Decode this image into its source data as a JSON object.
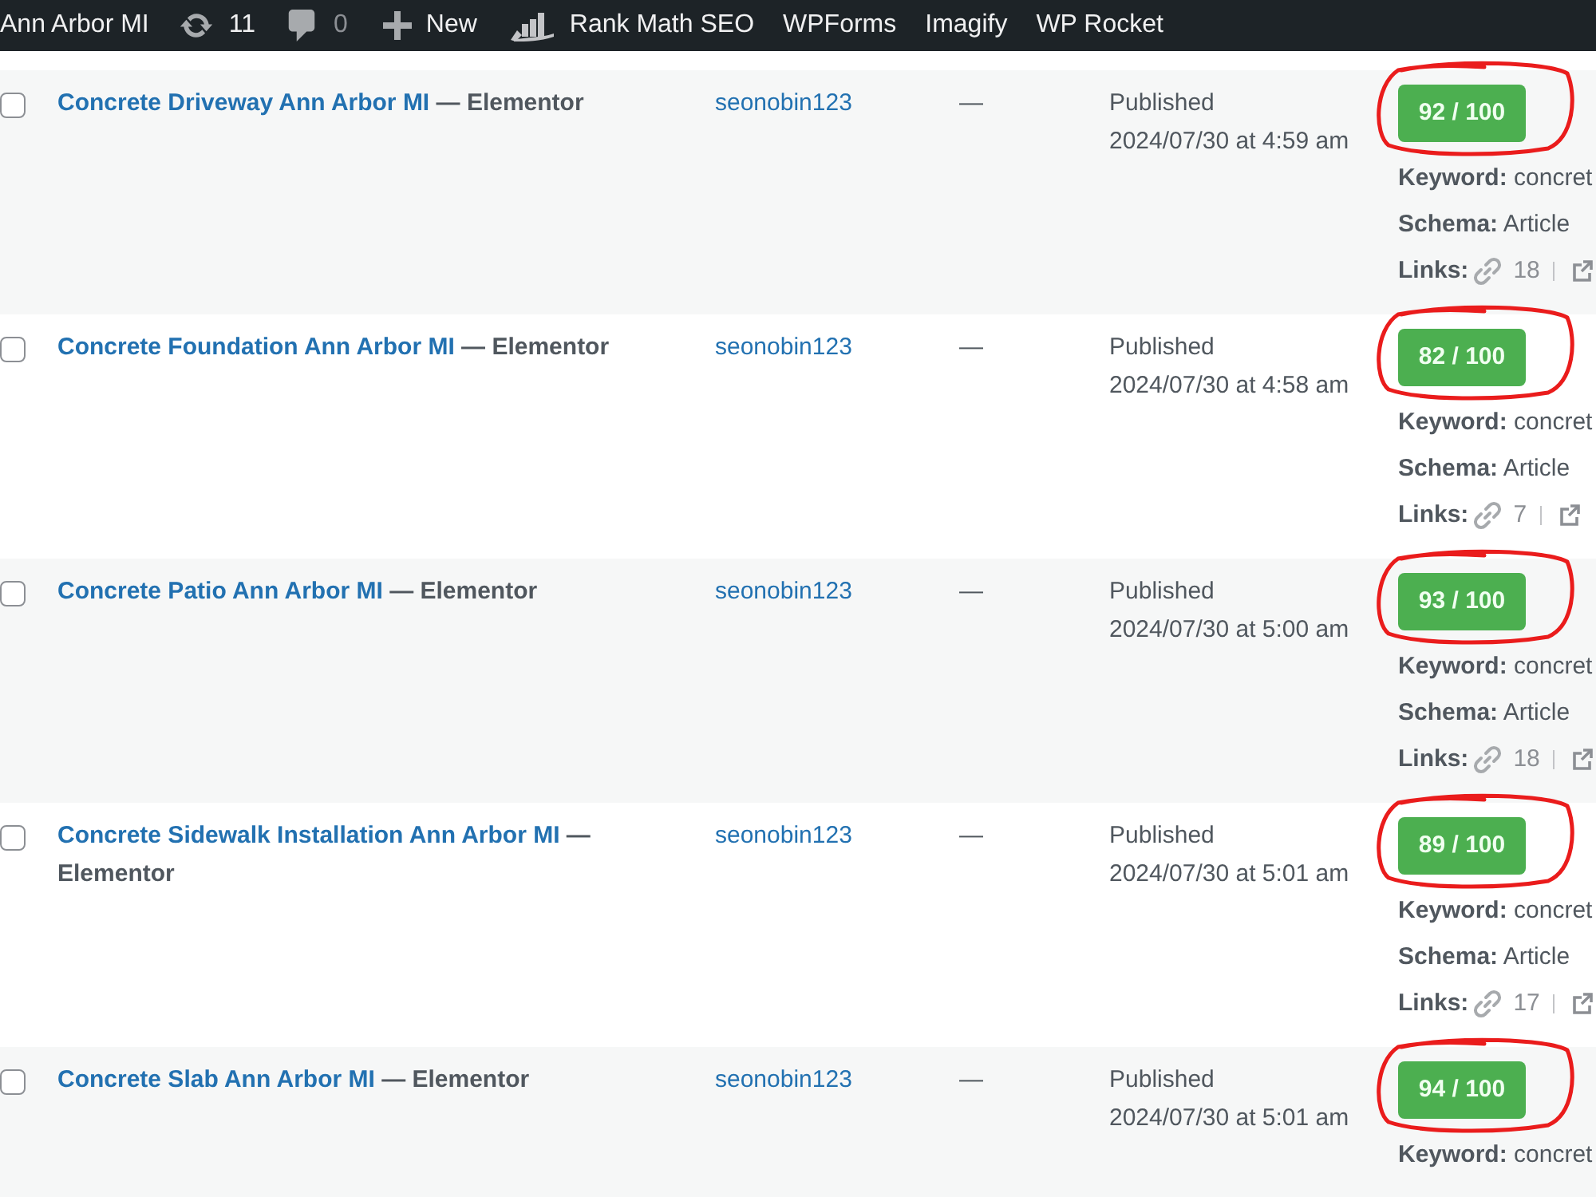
{
  "admin_bar": {
    "site_name": "Ann Arbor MI",
    "updates_count": "11",
    "comments_count": "0",
    "new_label": "New",
    "rank_math": "Rank Math SEO",
    "menus": [
      "WPForms",
      "Imagify",
      "WP Rocket"
    ]
  },
  "posts": [
    {
      "checked": false,
      "title": "Concrete Driveway Ann Arbor MI",
      "state": "— Elementor",
      "author": "seonobin123",
      "comments": "—",
      "status": "Published",
      "date": "2024/07/30 at 4:59 am",
      "seo_score": "92 / 100",
      "circled": true,
      "keyword_label": "Keyword:",
      "keyword": "concret",
      "schema_label": "Schema:",
      "schema": "Article",
      "links_label": "Links:",
      "internal_links": "18"
    },
    {
      "checked": false,
      "title": "Concrete Foundation Ann Arbor MI",
      "state": "— Elementor",
      "author": "seonobin123",
      "comments": "—",
      "status": "Published",
      "date": "2024/07/30 at 4:58 am",
      "seo_score": "82 / 100",
      "circled": true,
      "keyword_label": "Keyword:",
      "keyword": "concret",
      "schema_label": "Schema:",
      "schema": "Article",
      "links_label": "Links:",
      "internal_links": "7"
    },
    {
      "checked": false,
      "title": "Concrete Patio Ann Arbor MI",
      "state": "— Elementor",
      "author": "seonobin123",
      "comments": "—",
      "status": "Published",
      "date": "2024/07/30 at 5:00 am",
      "seo_score": "93 / 100",
      "circled": true,
      "keyword_label": "Keyword:",
      "keyword": "concret",
      "schema_label": "Schema:",
      "schema": "Article",
      "links_label": "Links:",
      "internal_links": "18"
    },
    {
      "checked": false,
      "title": "Concrete Sidewalk Installation Ann Arbor MI",
      "state": "— Elementor",
      "author": "seonobin123",
      "comments": "—",
      "status": "Published",
      "date": "2024/07/30 at 5:01 am",
      "seo_score": "89 / 100",
      "circled": true,
      "keyword_label": "Keyword:",
      "keyword": "concret",
      "schema_label": "Schema:",
      "schema": "Article",
      "links_label": "Links:",
      "internal_links": "17"
    },
    {
      "checked": false,
      "title": "Concrete Slab Ann Arbor MI",
      "state": "— Elementor",
      "author": "seonobin123",
      "comments": "—",
      "status": "Published",
      "date": "2024/07/30 at 5:01 am",
      "seo_score": "94 / 100",
      "circled": true,
      "keyword_label": "Keyword:",
      "keyword": "concret"
    }
  ]
}
